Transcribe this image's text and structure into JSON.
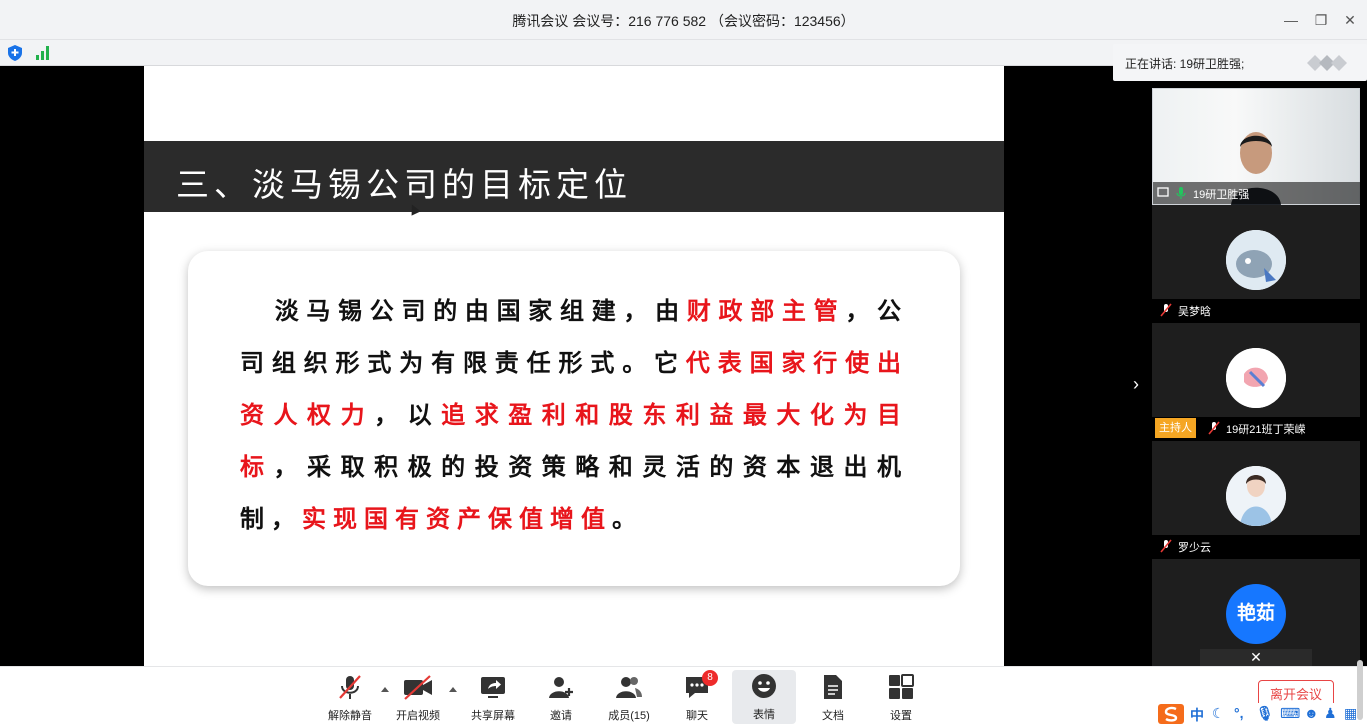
{
  "window": {
    "title": "腾讯会议 会议号：216 776 582 （会议密码：123456）"
  },
  "slide": {
    "title": "三、淡马锡公司的目标定位",
    "paragraph": [
      {
        "text": "淡马锡公司的由国家组建，由",
        "red": false
      },
      {
        "text": "财政部主管",
        "red": true
      },
      {
        "text": "，公司组织形式为有限责任形式。它",
        "red": false
      },
      {
        "text": "代表国家行使出资人权力",
        "red": true
      },
      {
        "text": "，以",
        "red": false
      },
      {
        "text": "追求盈利和股东利益最大化为目标",
        "red": true
      },
      {
        "text": "，采取积极的投资策略和灵活的资本退出机制，",
        "red": false
      },
      {
        "text": "实现国有资产保值增值",
        "red": true
      },
      {
        "text": "。",
        "red": false
      }
    ]
  },
  "sidebar": {
    "speaking_label": "正在讲话: 19研卫胜强;",
    "participants": [
      {
        "name": "19研卫胜强"
      },
      {
        "name": "吴梦晗"
      },
      {
        "name": "19研21班丁荣嵘",
        "role": "主持人"
      },
      {
        "name": "罗少云"
      },
      {
        "avatar_text": "艳茹"
      }
    ]
  },
  "toolbar": {
    "mute": "解除静音",
    "video": "开启视频",
    "share": "共享屏幕",
    "invite": "邀请",
    "members": "成员(15)",
    "chat": "聊天",
    "chat_badge": "8",
    "reactions": "表情",
    "docs": "文档",
    "settings": "设置",
    "leave": "离开会议"
  },
  "ime": {
    "mode": "中"
  },
  "colors": {
    "accent_red": "#e8151b",
    "host_badge": "#f5a623",
    "avatar_blue": "#1677ff"
  }
}
